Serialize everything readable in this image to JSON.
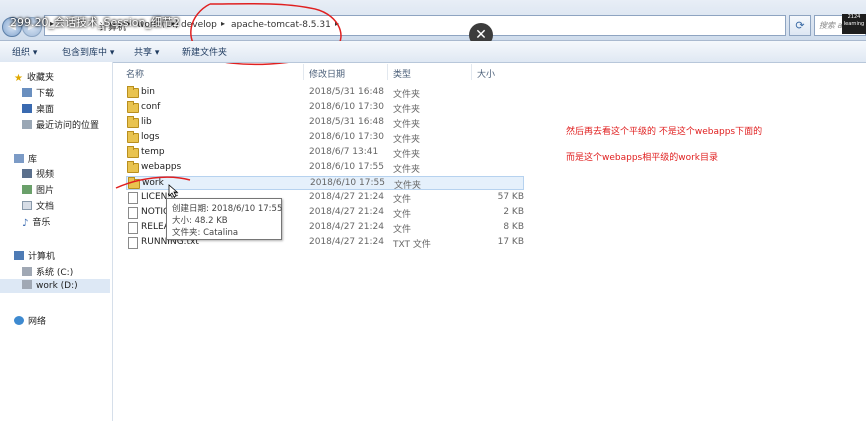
{
  "video_title": "299.20_会话技术_Session_细节2",
  "address_bar": {
    "segments": [
      "计算机",
      "work (D:)",
      "develop",
      "apache-tomcat-8.5.31"
    ],
    "search_placeholder": "搜索 apache..."
  },
  "logo_text": "2124 learning",
  "toolbar": {
    "organize": "组织 ▾",
    "include_in_library": "包含到库中 ▾",
    "share": "共享 ▾",
    "new_folder": "新建文件夹"
  },
  "nav": {
    "favorites": {
      "label": "收藏夹",
      "items": [
        "下载",
        "桌面",
        "最近访问的位置"
      ]
    },
    "libraries": {
      "label": "库",
      "items": [
        "视频",
        "图片",
        "文档",
        "音乐"
      ]
    },
    "computer": {
      "label": "计算机",
      "items": [
        "系统 (C:)",
        "work (D:)"
      ]
    },
    "network": {
      "label": "网络"
    }
  },
  "columns": [
    "名称",
    "修改日期",
    "类型",
    "大小"
  ],
  "files": [
    {
      "name": "bin",
      "date": "2018/5/31 16:48",
      "type": "文件夹",
      "size": "",
      "kind": "folder"
    },
    {
      "name": "conf",
      "date": "2018/6/10 17:30",
      "type": "文件夹",
      "size": "",
      "kind": "folder"
    },
    {
      "name": "lib",
      "date": "2018/5/31 16:48",
      "type": "文件夹",
      "size": "",
      "kind": "folder"
    },
    {
      "name": "logs",
      "date": "2018/6/10 17:30",
      "type": "文件夹",
      "size": "",
      "kind": "folder"
    },
    {
      "name": "temp",
      "date": "2018/6/7 13:41",
      "type": "文件夹",
      "size": "",
      "kind": "folder"
    },
    {
      "name": "webapps",
      "date": "2018/6/10 17:55",
      "type": "文件夹",
      "size": "",
      "kind": "folder"
    },
    {
      "name": "work",
      "date": "2018/6/10 17:55",
      "type": "文件夹",
      "size": "",
      "kind": "folder"
    },
    {
      "name": "LICENSE",
      "date": "2018/4/27 21:24",
      "type": "文件",
      "size": "57 KB",
      "kind": "file"
    },
    {
      "name": "NOTICE",
      "date": "2018/4/27 21:24",
      "type": "文件",
      "size": "2 KB",
      "kind": "file"
    },
    {
      "name": "RELEASE",
      "date": "2018/4/27 21:24",
      "type": "文件",
      "size": "8 KB",
      "kind": "file"
    },
    {
      "name": "RUNNING.txt",
      "date": "2018/4/27 21:24",
      "type": "TXT 文件",
      "size": "17 KB",
      "kind": "file"
    }
  ],
  "tooltip": {
    "created": "创建日期: 2018/6/10 17:55",
    "size": "大小: 48.2 KB",
    "folders": "文件夹: Catalina"
  },
  "notes": [
    "然后再去看这个平级的 不是这个webapps下面的",
    "而是这个webapps相平级的work目录"
  ],
  "colors": {
    "annotation": "#e02020",
    "folder": "#e9c34f",
    "selection": "#e5f0fb"
  }
}
